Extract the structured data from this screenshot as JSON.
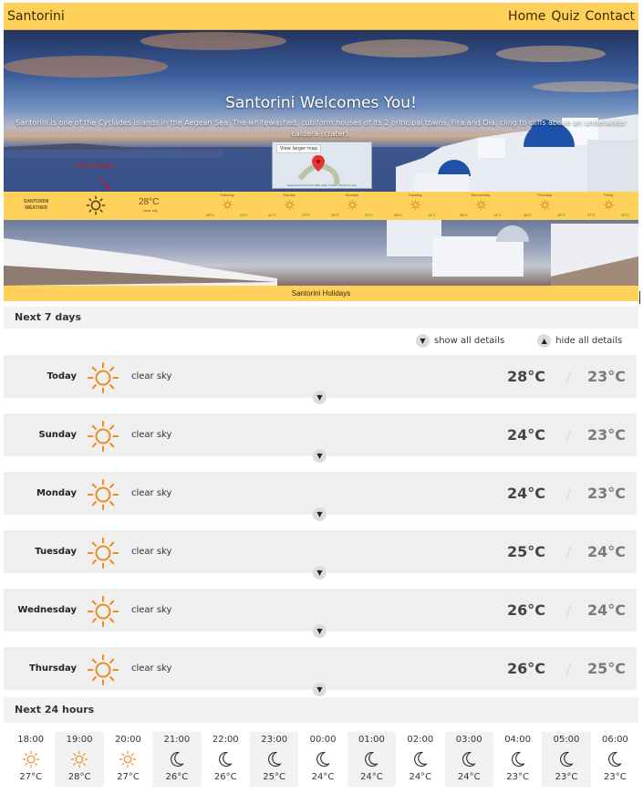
{
  "nav": {
    "brand": "Santorini",
    "links": [
      "Home",
      "Quiz",
      "Contact"
    ]
  },
  "hero": {
    "title": "Santorini Welcomes You!",
    "subtitle": "Santorini is one of the Cyclades islands in the Aegean Sea. The whitewashed, cubiform houses of its 2 principal towns, Fira and Oia, cling to cliffs above an underwater caldera (crater).",
    "map_button": "View larger map",
    "map_footer": "Keyboard shortcuts   Map data ©2021   Terms of use",
    "click_here": "Click Here"
  },
  "widget": {
    "city": "SANTORINI",
    "label": "WEATHER",
    "temp": "28°C",
    "desc": "clear sky",
    "days": [
      {
        "name": "Saturday",
        "hi": "28°C",
        "lo": "23°C"
      },
      {
        "name": "Sunday",
        "hi": "24°C",
        "lo": "23°C"
      },
      {
        "name": "Monday",
        "hi": "24°C",
        "lo": "23°C"
      },
      {
        "name": "Tuesday",
        "hi": "25°C",
        "lo": "24°C"
      },
      {
        "name": "Wednesday",
        "hi": "26°C",
        "lo": "24°C"
      },
      {
        "name": "Thursday",
        "hi": "26°C",
        "lo": "25°C"
      },
      {
        "name": "Friday",
        "hi": "27°C",
        "lo": "25°C"
      }
    ]
  },
  "footer_bar": "Santorini Holidays",
  "forecast": {
    "next7_heading": "Next 7 days",
    "show_all": "show all details",
    "hide_all": "hide all details",
    "days": [
      {
        "name": "Today",
        "desc": "clear sky",
        "hi": "28°C",
        "lo": "23°C"
      },
      {
        "name": "Sunday",
        "desc": "clear sky",
        "hi": "24°C",
        "lo": "23°C"
      },
      {
        "name": "Monday",
        "desc": "clear sky",
        "hi": "24°C",
        "lo": "23°C"
      },
      {
        "name": "Tuesday",
        "desc": "clear sky",
        "hi": "25°C",
        "lo": "24°C"
      },
      {
        "name": "Wednesday",
        "desc": "clear sky",
        "hi": "26°C",
        "lo": "24°C"
      },
      {
        "name": "Thursday",
        "desc": "clear sky",
        "hi": "26°C",
        "lo": "25°C"
      }
    ],
    "separator": "/",
    "next24_heading": "Next 24 hours",
    "hours": [
      {
        "time": "18:00",
        "icon": "sun-icon",
        "temp": "27°C"
      },
      {
        "time": "19:00",
        "icon": "sun-icon",
        "temp": "28°C"
      },
      {
        "time": "20:00",
        "icon": "sun-icon",
        "temp": "27°C"
      },
      {
        "time": "21:00",
        "icon": "moon-icon",
        "temp": "26°C"
      },
      {
        "time": "22:00",
        "icon": "moon-icon",
        "temp": "26°C"
      },
      {
        "time": "23:00",
        "icon": "moon-icon",
        "temp": "25°C"
      },
      {
        "time": "00:00",
        "icon": "moon-icon",
        "temp": "24°C"
      },
      {
        "time": "01:00",
        "icon": "moon-icon",
        "temp": "24°C"
      },
      {
        "time": "02:00",
        "icon": "moon-icon",
        "temp": "24°C"
      },
      {
        "time": "03:00",
        "icon": "moon-icon",
        "temp": "24°C"
      },
      {
        "time": "04:00",
        "icon": "moon-icon",
        "temp": "23°C"
      },
      {
        "time": "05:00",
        "icon": "moon-icon",
        "temp": "23°C"
      },
      {
        "time": "06:00",
        "icon": "moon-icon",
        "temp": "23°C"
      }
    ]
  },
  "colors": {
    "accent": "#ffd05a",
    "sun": "#f08a1c",
    "low_temp_widget": "#2e8a34"
  }
}
